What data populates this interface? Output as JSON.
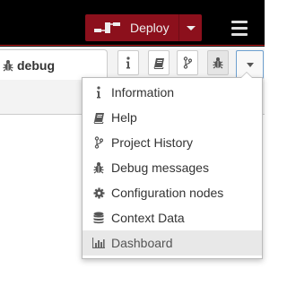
{
  "header": {
    "deploy_label": "Deploy"
  },
  "sidebar": {
    "active_tab": {
      "label": "debug",
      "icon": "bug-icon"
    },
    "toolbar_icons": [
      "info-icon",
      "book-icon",
      "branch-icon",
      "bug-icon",
      "chevron-down-icon"
    ]
  },
  "menu": {
    "items": [
      {
        "label": "Information",
        "icon": "info-icon"
      },
      {
        "label": "Help",
        "icon": "book-icon"
      },
      {
        "label": "Project History",
        "icon": "branch-icon"
      },
      {
        "label": "Debug messages",
        "icon": "bug-icon"
      },
      {
        "label": "Configuration nodes",
        "icon": "gear-icon"
      },
      {
        "label": "Context Data",
        "icon": "database-icon"
      },
      {
        "label": "Dashboard",
        "icon": "bar-chart-icon"
      }
    ],
    "highlighted_item": "Dashboard"
  },
  "colors": {
    "header_bg": "#000000",
    "deploy_bg": "#8c101c",
    "accent_line": "#c02020",
    "highlight_bg": "#e8e8e8"
  }
}
